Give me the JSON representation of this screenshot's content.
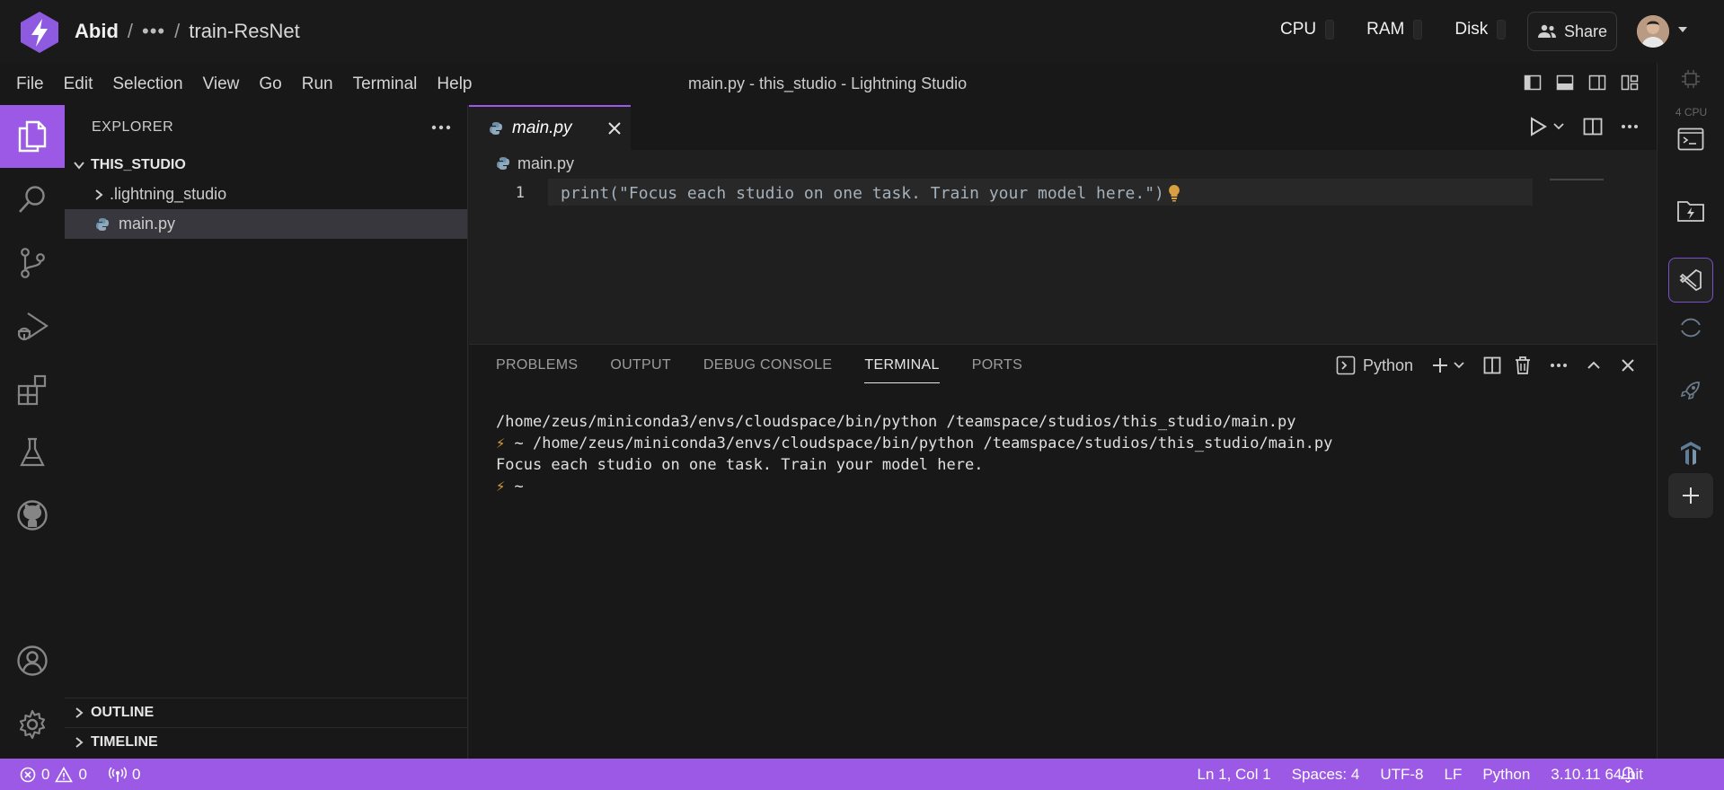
{
  "topbar": {
    "user": "Abid",
    "separator": "/",
    "ellipsis": "•••",
    "project": "train-ResNet",
    "meters": [
      "CPU",
      "RAM",
      "Disk"
    ],
    "share_label": "Share"
  },
  "menubar": {
    "items": [
      "File",
      "Edit",
      "Selection",
      "View",
      "Go",
      "Run",
      "Terminal",
      "Help"
    ],
    "window_title": "main.py - this_studio - Lightning Studio"
  },
  "activity": {
    "icons": [
      "explorer-icon",
      "search-icon",
      "source-control-icon",
      "run-debug-icon",
      "extensions-icon",
      "testing-icon",
      "github-icon",
      "account-icon",
      "settings-icon"
    ]
  },
  "sidebar": {
    "header": "EXPLORER",
    "root": "THIS_STUDIO",
    "items": [
      ".lightning_studio",
      "main.py"
    ],
    "outline": "OUTLINE",
    "timeline": "TIMELINE"
  },
  "editor": {
    "tab_label": "main.py",
    "breadcrumb": "main.py",
    "line_number": "1",
    "code_line": "print(\"Focus each studio on one task. Train your model here.\")"
  },
  "panel": {
    "tabs": [
      "PROBLEMS",
      "OUTPUT",
      "DEBUG CONSOLE",
      "TERMINAL",
      "PORTS"
    ],
    "active_tab": "TERMINAL",
    "shell_label": "Python",
    "terminal": {
      "line1": "/home/zeus/miniconda3/envs/cloudspace/bin/python /teamspace/studios/this_studio/main.py",
      "line2_prompt": "⚡",
      "line2": " ~ /home/zeus/miniconda3/envs/cloudspace/bin/python /teamspace/studios/this_studio/main.py",
      "line3": "Focus each studio on one task. Train your model here.",
      "line4_prompt": "⚡",
      "line4": " ~"
    }
  },
  "rightrail": {
    "cpu_label": "4 CPU"
  },
  "statusbar": {
    "errors": "0",
    "warnings": "0",
    "ports": "0",
    "position": "Ln 1, Col 1",
    "spaces": "Spaces: 4",
    "encoding": "UTF-8",
    "eol": "LF",
    "language": "Python",
    "interpreter": "3.10.11 64-bit"
  },
  "colors": {
    "accent": "#9b59e6",
    "bolt": "#e0a040"
  }
}
